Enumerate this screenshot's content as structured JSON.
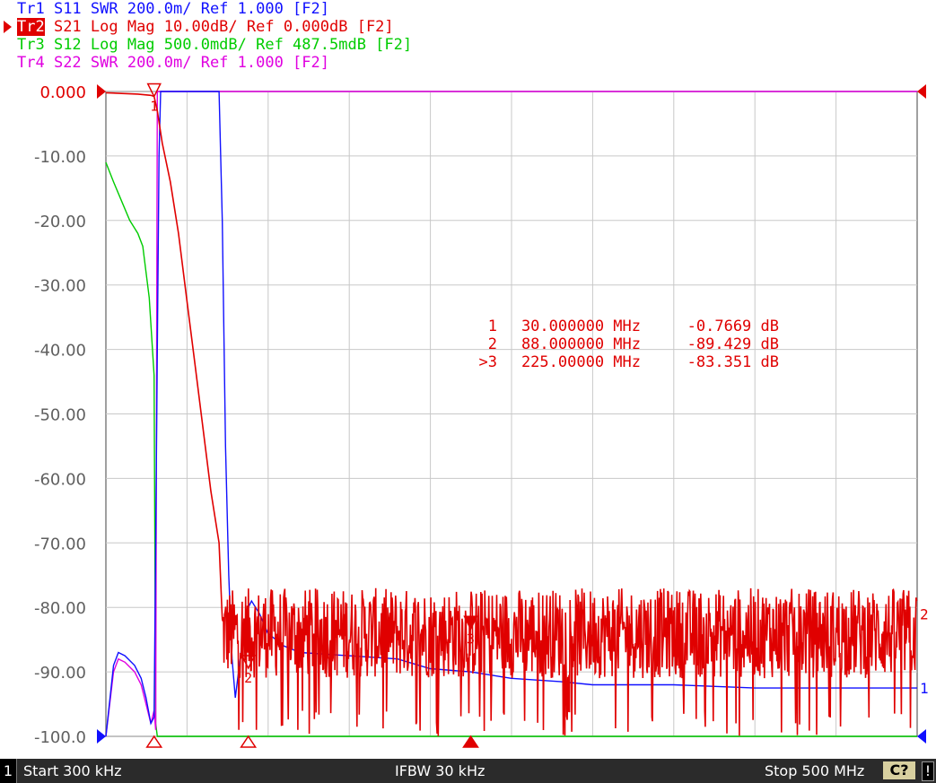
{
  "traces": [
    {
      "tag": "Tr1",
      "param": "S11",
      "format": "SWR",
      "scale": "200.0m/",
      "ref": "Ref 1.000",
      "chan": "[F2]",
      "color": "#1010ff",
      "active": false
    },
    {
      "tag": "Tr2",
      "param": "S21",
      "format": "Log Mag",
      "scale": "10.00dB/",
      "ref": "Ref 0.000dB",
      "chan": "[F2]",
      "color": "#e00000",
      "active": true
    },
    {
      "tag": "Tr3",
      "param": "S12",
      "format": "Log Mag",
      "scale": "500.0mdB/",
      "ref": "Ref 487.5mdB",
      "chan": "[F2]",
      "color": "#00cc00",
      "active": false
    },
    {
      "tag": "Tr4",
      "param": "S22",
      "format": "SWR",
      "scale": "200.0m/",
      "ref": "Ref 1.000",
      "chan": "[F2]",
      "color": "#e000e0",
      "active": false
    }
  ],
  "status": {
    "channel": "1",
    "start": "Start 300 kHz",
    "ifbw": "IFBW 30 kHz",
    "stop": "Stop 500 MHz",
    "cal": "C?",
    "warn": "!"
  },
  "colors": {
    "tr1": "#1010ff",
    "tr2": "#e00000",
    "tr3": "#00cc00",
    "tr4": "#e000e0",
    "grid": "#c8c8c8"
  },
  "chart_data": {
    "type": "line",
    "title": "",
    "xlabel": "",
    "ylabel": "",
    "xlim_mhz": [
      0.3,
      500
    ],
    "ylim": [
      -100,
      0
    ],
    "yticks": [
      {
        "value": 0,
        "label": "0.000"
      },
      {
        "value": -10,
        "label": "-10.00"
      },
      {
        "value": -20,
        "label": "-20.00"
      },
      {
        "value": -30,
        "label": "-30.00"
      },
      {
        "value": -40,
        "label": "-40.00"
      },
      {
        "value": -50,
        "label": "-50.00"
      },
      {
        "value": -60,
        "label": "-60.00"
      },
      {
        "value": -70,
        "label": "-70.00"
      },
      {
        "value": -80,
        "label": "-80.00"
      },
      {
        "value": -90,
        "label": "-90.00"
      },
      {
        "value": -100,
        "label": "-100.0"
      }
    ],
    "grid": true,
    "x_divisions": 10,
    "series": [
      {
        "name": "Tr1",
        "color": "#1010ff",
        "x": [
          0.3,
          5,
          8,
          12,
          18,
          22,
          25,
          28,
          30,
          31,
          32,
          33,
          34,
          35,
          36,
          70,
          72,
          74,
          76,
          78,
          80,
          82,
          84,
          86,
          88,
          90,
          95,
          100,
          110,
          120,
          150,
          180,
          200,
          225,
          250,
          280,
          300,
          350,
          400,
          450,
          500
        ],
        "y": [
          -100,
          -89,
          -87,
          -87.5,
          -89,
          -91,
          -94,
          -98,
          -97,
          -70,
          -40,
          -10,
          0,
          0,
          0,
          0,
          -20,
          -55,
          -75,
          -88,
          -94,
          -90,
          -86,
          -82,
          -80,
          -79,
          -81,
          -84,
          -86,
          -87,
          -87.5,
          -88,
          -89.5,
          -90,
          -91,
          -91.5,
          -92,
          -92,
          -92.5,
          -92.5,
          -92.5
        ]
      },
      {
        "name": "Tr2",
        "color": "#e00000",
        "x": [
          0.3,
          10,
          20,
          28,
          30,
          32,
          35,
          40,
          45,
          50,
          55,
          60,
          65,
          70,
          75,
          80,
          85,
          88,
          95,
          100,
          150,
          200,
          225,
          250,
          300,
          350,
          400,
          450,
          500
        ],
        "y": [
          -0.2,
          -0.3,
          -0.4,
          -0.6,
          -0.77,
          -3,
          -8,
          -14,
          -22,
          -32,
          -42,
          -52,
          -62,
          -70,
          -77,
          -82,
          -86,
          -89.4,
          -84,
          -84,
          -84,
          -84,
          -83.4,
          -84,
          -84,
          -84,
          -84,
          -84,
          -84
        ],
        "noise_from_mhz": 72,
        "noise_center_db": -84,
        "noise_spread_db": 7
      },
      {
        "name": "Tr3",
        "color": "#00cc00",
        "x": [
          0.3,
          5,
          10,
          15,
          20,
          23,
          25,
          27,
          28,
          29,
          30,
          31,
          32,
          40,
          500
        ],
        "y": [
          -11,
          -14,
          -17,
          -20,
          -22,
          -24,
          -28,
          -32,
          -36,
          -40,
          -44,
          -98,
          -100,
          -100,
          -100
        ]
      },
      {
        "name": "Tr4",
        "color": "#e000e0",
        "x": [
          0.3,
          5,
          8,
          12,
          18,
          22,
          25,
          28,
          30,
          31,
          32,
          500
        ],
        "y": [
          -100,
          -90,
          -88,
          -88.5,
          -90,
          -92,
          -95,
          -98,
          -96,
          -99,
          0,
          0
        ]
      }
    ],
    "markers": [
      {
        "num": "1",
        "freq": "30.000000 MHz",
        "value": "-0.7669 dB",
        "active": false,
        "x_mhz": 30,
        "y_db": -0.77
      },
      {
        "num": "2",
        "freq": "88.000000 MHz",
        "value": "-89.429 dB",
        "active": false,
        "x_mhz": 88,
        "y_db": -89.43
      },
      {
        "num": "3",
        "freq": "225.00000 MHz",
        "value": "-83.351 dB",
        "active": true,
        "x_mhz": 225,
        "y_db": -83.35
      }
    ],
    "marker_prefix_active": ">",
    "end_labels": [
      {
        "text": "2",
        "color": "#e00000",
        "y_db": -81
      },
      {
        "text": "1",
        "color": "#1010ff",
        "y_db": -92.5
      }
    ]
  }
}
